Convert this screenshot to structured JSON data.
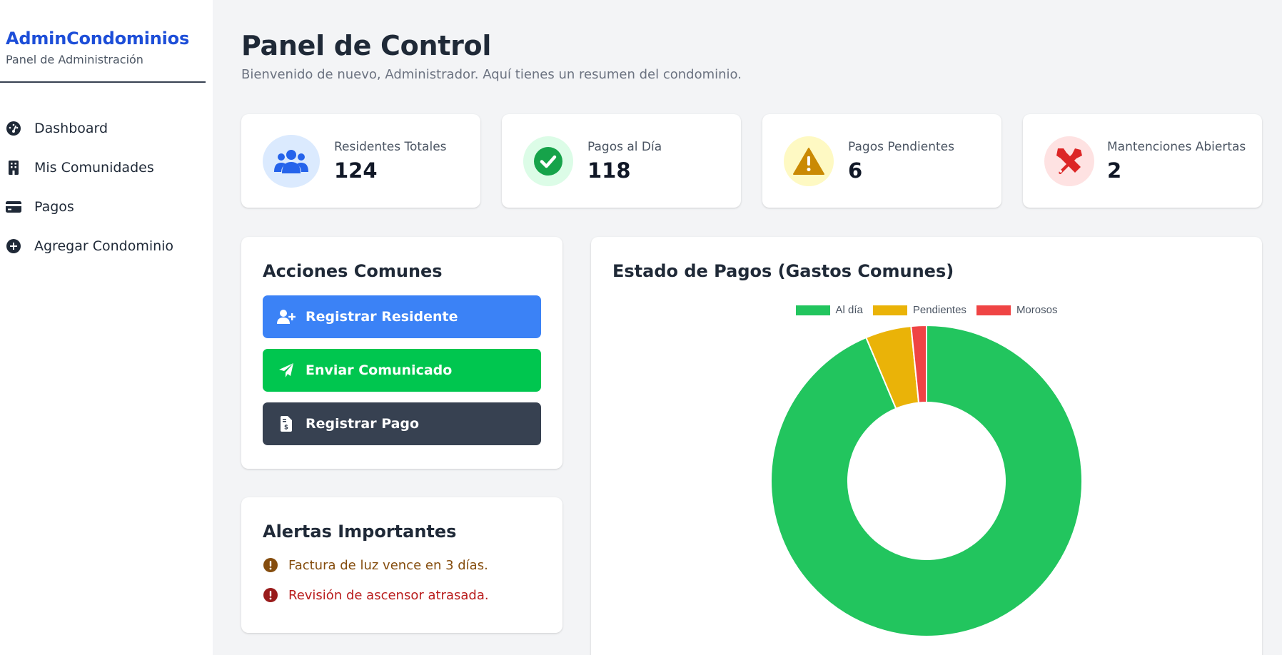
{
  "brand": {
    "title": "AdminCondominios",
    "subtitle": "Panel de Administración"
  },
  "nav": {
    "items": [
      {
        "label": "Dashboard",
        "icon": "gauge-icon"
      },
      {
        "label": "Mis Comunidades",
        "icon": "building-icon"
      },
      {
        "label": "Pagos",
        "icon": "credit-card-icon"
      },
      {
        "label": "Agregar Condominio",
        "icon": "plus-circle-icon"
      }
    ]
  },
  "header": {
    "title": "Panel de Control",
    "subtitle": "Bienvenido de nuevo, Administrador. Aquí tienes un resumen del condominio."
  },
  "stats": [
    {
      "label": "Residentes Totales",
      "value": "124",
      "icon": "users-icon",
      "bg": "#dbeafe",
      "color": "#2563eb"
    },
    {
      "label": "Pagos al Día",
      "value": "118",
      "icon": "check-circle-icon",
      "bg": "#dcfce7",
      "color": "#16a34a"
    },
    {
      "label": "Pagos Pendientes",
      "value": "6",
      "icon": "warning-icon",
      "bg": "#fef9c3",
      "color": "#ca8a04"
    },
    {
      "label": "Mantenciones Abiertas",
      "value": "2",
      "icon": "tools-icon",
      "bg": "#fee2e2",
      "color": "#dc2626"
    }
  ],
  "actions": {
    "title": "Acciones Comunes",
    "buttons": [
      {
        "label": "Registrar Residente",
        "icon": "user-plus-icon",
        "color": "#3b82f6"
      },
      {
        "label": "Enviar Comunicado",
        "icon": "paper-plane-icon",
        "color": "#00c64f"
      },
      {
        "label": "Registrar Pago",
        "icon": "invoice-dollar-icon",
        "color": "#374151"
      }
    ]
  },
  "alerts": {
    "title": "Alertas Importantes",
    "items": [
      {
        "text": "Factura de luz vence en 3 días.",
        "color": "#854d0e",
        "icon_color": "#854d0e"
      },
      {
        "text": "Revisión de ascensor atrasada.",
        "color": "#b91c1c",
        "icon_color": "#991b1b"
      }
    ]
  },
  "chart": {
    "title": "Estado de Pagos (Gastos Comunes)"
  },
  "chart_data": {
    "type": "pie",
    "title": "Estado de Pagos (Gastos Comunes)",
    "categories": [
      "Al día",
      "Pendientes",
      "Morosos"
    ],
    "values": [
      118,
      6,
      2
    ],
    "colors": [
      "#22c55e",
      "#eab308",
      "#ef4444"
    ],
    "donut": true,
    "legend_position": "top"
  }
}
